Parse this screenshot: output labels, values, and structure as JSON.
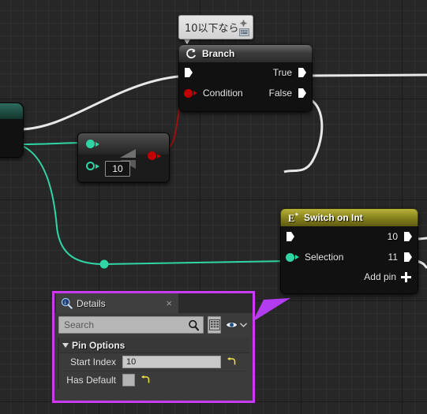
{
  "app": {
    "context": "unreal-blueprint-graph"
  },
  "comment_bubble": {
    "text": "10以下なら",
    "pin_icon": "pushpin-icon",
    "keyboard_icon": "keyboard-icon"
  },
  "nodes": {
    "branch": {
      "title": "Branch",
      "icon": "branch-loop-icon",
      "header_color": "#3d3d3d",
      "inputs": [
        {
          "label": "",
          "pin": "exec",
          "color": "#ffffff"
        },
        {
          "label": "Condition",
          "pin": "bool",
          "color": "#c00000"
        }
      ],
      "outputs": [
        {
          "label": "True",
          "pin": "exec",
          "color": "#ffffff"
        },
        {
          "label": "False",
          "pin": "exec",
          "color": "#ffffff"
        }
      ]
    },
    "switch_on_int": {
      "title": "Switch on Int",
      "icon": "switch-e-icon",
      "header_color": "#8d8820",
      "inputs": [
        {
          "label": "",
          "pin": "exec",
          "color": "#ffffff"
        },
        {
          "label": "Selection",
          "pin": "int",
          "color": "#2fd6a3"
        }
      ],
      "outputs": [
        {
          "label": "10",
          "pin": "exec",
          "color": "#ffffff"
        },
        {
          "label": "11",
          "pin": "exec",
          "color": "#ffffff"
        }
      ],
      "add_pin_label": "Add pin"
    },
    "compare": {
      "title": "",
      "glyph": "less-than-equal-glyph",
      "literal_value": "10",
      "input_a_color": "#2fd6a3",
      "input_b_color": "#2fd6a3",
      "output_color": "#c00000"
    },
    "left_partial": {
      "title": "",
      "exec_color": "#ffffff",
      "data_color": "#2fd6a3"
    }
  },
  "wires": {
    "exec_color": "#e8e8e8",
    "bool_color": "#a01010",
    "int_color": "#2fd6a3",
    "reroute_label": "reroute-node"
  },
  "details_panel": {
    "tab_title": "Details",
    "tab_icon": "details-magnifier-icon",
    "close_label": "×",
    "search": {
      "placeholder": "Search",
      "value": "",
      "icon": "search-icon"
    },
    "toolbar": {
      "grid_button": "grid-view-icon",
      "eye_button": "visibility-eye-icon",
      "chevron": "chevron-down-icon"
    },
    "section": {
      "title": "Pin Options",
      "expanded": true,
      "properties": [
        {
          "name": "Start Index",
          "type": "text",
          "value": "10",
          "revert": "revert-arrow-icon"
        },
        {
          "name": "Has Default",
          "type": "checkbox",
          "value": "",
          "checked": false,
          "revert": "revert-arrow-icon"
        }
      ]
    },
    "highlight_color": "#c83cf0"
  },
  "callout": {
    "arrow_color": "#b43cf0",
    "name": "callout-arrow"
  }
}
